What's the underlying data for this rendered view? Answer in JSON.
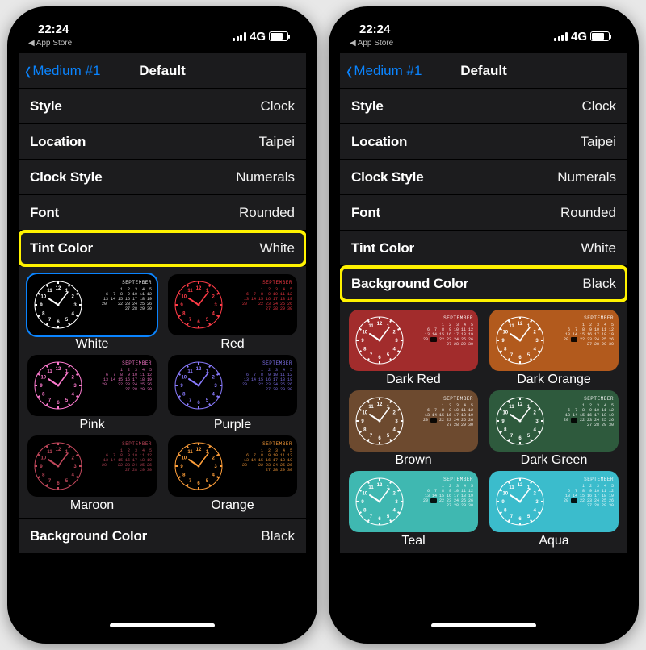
{
  "status": {
    "time": "22:24",
    "network": "4G",
    "back_app": "App Store"
  },
  "nav": {
    "back": "Medium #1",
    "title": "Default"
  },
  "rows": {
    "style": {
      "label": "Style",
      "value": "Clock"
    },
    "location": {
      "label": "Location",
      "value": "Taipei"
    },
    "clock_style": {
      "label": "Clock Style",
      "value": "Numerals"
    },
    "font": {
      "label": "Font",
      "value": "Rounded"
    },
    "tint_color": {
      "label": "Tint Color",
      "value": "White"
    },
    "background_color": {
      "label": "Background Color",
      "value": "Black"
    }
  },
  "calendar_month": "SEPTEMBER",
  "left_phone": {
    "highlighted_row": "tint_color",
    "options_for": "tint_color",
    "options": [
      {
        "label": "White",
        "fg": "#ffffff",
        "bg": "#000000",
        "selected": true
      },
      {
        "label": "Red",
        "fg": "#ff3b47",
        "bg": "#000000"
      },
      {
        "label": "Pink",
        "fg": "#ff7bd0",
        "bg": "#000000"
      },
      {
        "label": "Purple",
        "fg": "#8a7bff",
        "bg": "#000000"
      },
      {
        "label": "Maroon",
        "fg": "#c2485c",
        "bg": "#000000"
      },
      {
        "label": "Orange",
        "fg": "#ff9f3a",
        "bg": "#000000"
      }
    ]
  },
  "right_phone": {
    "highlighted_row": "background_color",
    "options_for": "background_color",
    "options": [
      {
        "label": "Dark Red",
        "fg": "#ffffff",
        "bg": "#a22c2c"
      },
      {
        "label": "Dark Orange",
        "fg": "#ffffff",
        "bg": "#b25a1d"
      },
      {
        "label": "Brown",
        "fg": "#ffffff",
        "bg": "#6d4a2f"
      },
      {
        "label": "Dark Green",
        "fg": "#ffffff",
        "bg": "#2e5a3d"
      },
      {
        "label": "Teal",
        "fg": "#ffffff",
        "bg": "#3fb8b1"
      },
      {
        "label": "Aqua",
        "fg": "#ffffff",
        "bg": "#3bbccc"
      }
    ]
  }
}
